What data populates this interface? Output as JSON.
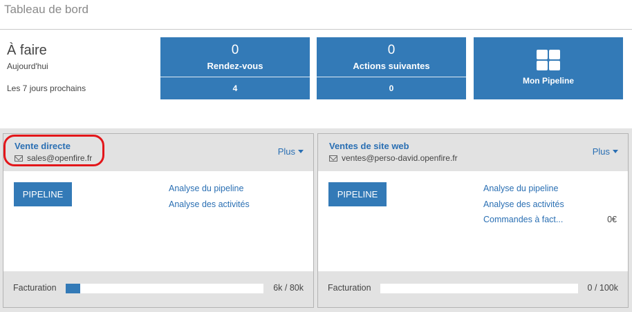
{
  "page": {
    "title": "Tableau de bord"
  },
  "todo": {
    "heading": "À faire",
    "today_label": "Aujourd'hui",
    "week_label": "Les 7 jours prochains"
  },
  "stats": [
    {
      "count": "0",
      "label": "Rendez-vous",
      "week_count": "4"
    },
    {
      "count": "0",
      "label": "Actions suivantes",
      "week_count": "0"
    }
  ],
  "pipeline_tile": {
    "label": "Mon Pipeline",
    "icon": "grid-icon"
  },
  "teams": [
    {
      "name": "Vente directe",
      "email": "sales@openfire.fr",
      "menu_label": "Plus",
      "button_label": "PIPELINE",
      "links": [
        "Analyse du pipeline",
        "Analyse des activités"
      ],
      "orders": null,
      "footer_label": "Facturation",
      "progress": 0.075,
      "footer_value": "6k / 80k"
    },
    {
      "name": "Ventes de site web",
      "email": "ventes@perso-david.openfire.fr",
      "menu_label": "Plus",
      "button_label": "PIPELINE",
      "links": [
        "Analyse du pipeline",
        "Analyse des activités"
      ],
      "orders": {
        "label": "Commandes à fact...",
        "amount": "0€"
      },
      "footer_label": "Facturation",
      "progress": 0,
      "footer_value": "0 / 100k"
    }
  ],
  "colors": {
    "accent": "#337ab7",
    "link": "#2a6fb3",
    "highlight": "#e3161a"
  }
}
